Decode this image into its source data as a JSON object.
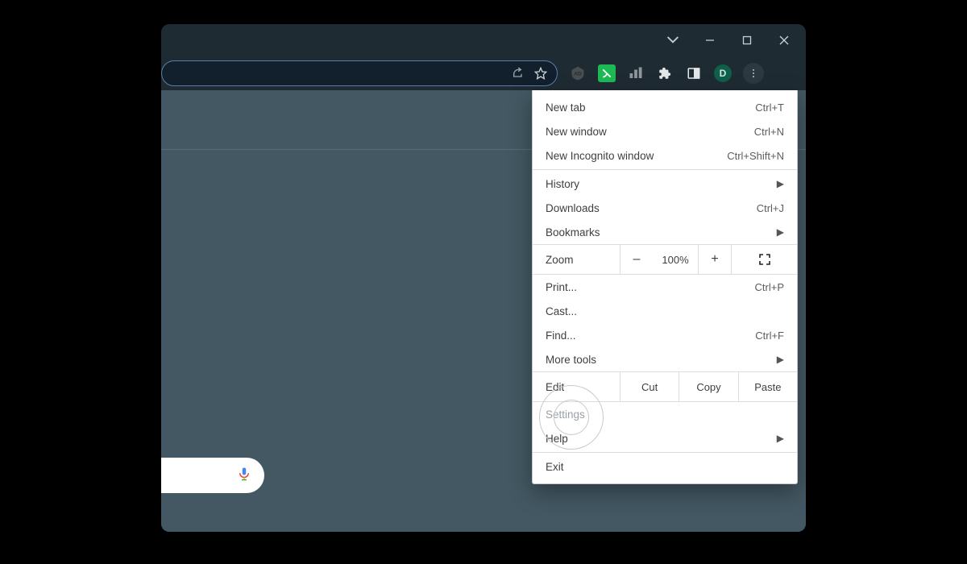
{
  "window_controls": {
    "chevron": "⌄"
  },
  "toolbar": {
    "avatar_initial": "D"
  },
  "menu": {
    "section1": [
      {
        "label": "New tab",
        "shortcut": "Ctrl+T"
      },
      {
        "label": "New window",
        "shortcut": "Ctrl+N"
      },
      {
        "label": "New Incognito window",
        "shortcut": "Ctrl+Shift+N"
      }
    ],
    "section2": [
      {
        "label": "History",
        "arrow": true
      },
      {
        "label": "Downloads",
        "shortcut": "Ctrl+J"
      },
      {
        "label": "Bookmarks",
        "arrow": true
      }
    ],
    "zoom": {
      "label": "Zoom",
      "minus": "–",
      "pct": "100%",
      "plus": "+"
    },
    "section3": [
      {
        "label": "Print...",
        "shortcut": "Ctrl+P"
      },
      {
        "label": "Cast..."
      },
      {
        "label": "Find...",
        "shortcut": "Ctrl+F"
      },
      {
        "label": "More tools",
        "arrow": true
      }
    ],
    "edit": {
      "label": "Edit",
      "cut": "Cut",
      "copy": "Copy",
      "paste": "Paste"
    },
    "section4": [
      {
        "label": "Settings"
      },
      {
        "label": "Help",
        "arrow": true
      }
    ],
    "section5": [
      {
        "label": "Exit"
      }
    ]
  }
}
